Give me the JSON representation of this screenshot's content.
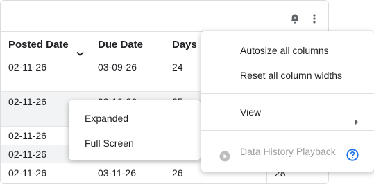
{
  "table": {
    "columns": [
      {
        "label": "Posted Date",
        "sort_icon": "chevron-down-icon"
      },
      {
        "label": "Due Date"
      },
      {
        "label": "Days "
      }
    ],
    "rows": [
      {
        "cells": [
          "02-11-26",
          "03-09-26",
          "24",
          ""
        ]
      },
      {
        "cells": [
          "02-11-26",
          "03-10-26",
          "25",
          ""
        ]
      },
      {
        "cells": [
          "02-11-26",
          "",
          "",
          ""
        ]
      },
      {
        "cells": [
          "02-11-26",
          "",
          "",
          ""
        ]
      },
      {
        "cells": [
          "02-11-26",
          "03-11-26",
          "26",
          "28"
        ]
      }
    ]
  },
  "toolbar": {
    "icons": [
      "alert-bell-icon",
      "more-vert-icon"
    ]
  },
  "view_submenu": {
    "items": [
      "Expanded",
      "Full Screen"
    ]
  },
  "column_menu": {
    "items": [
      {
        "label": "Autosize all columns"
      },
      {
        "label": "Reset all column widths"
      },
      {
        "label": "View",
        "icon": "chevron-right-icon"
      },
      {
        "label": "Data History Playback",
        "disabled": true,
        "icon": "play-circle-icon",
        "help_icon": "help-circle-icon"
      }
    ]
  },
  "colors": {
    "accent": "#1a73e8",
    "alt_row": "#f1f3f4",
    "border": "#dadce0",
    "disabled_text": "#a0a0a0"
  }
}
